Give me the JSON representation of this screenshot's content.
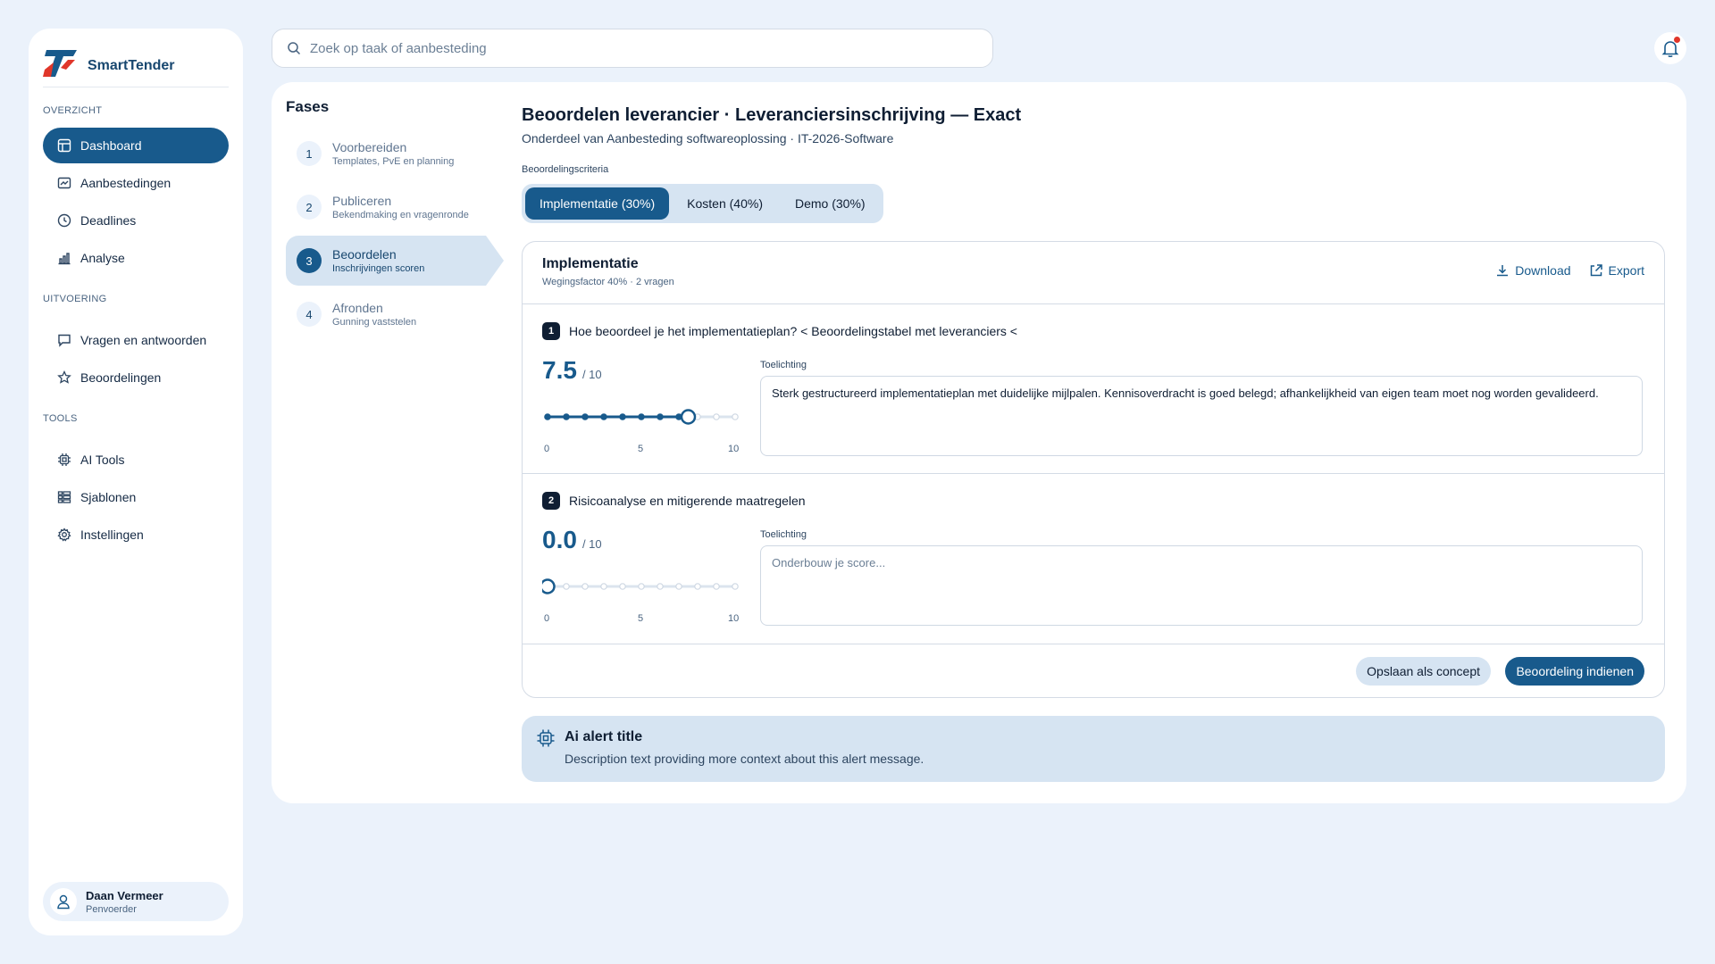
{
  "brand": {
    "name": "SmartTender"
  },
  "sidebar": {
    "sections": {
      "overview": "OVERZICHT",
      "execution": "UITVOERING",
      "tools": "TOOLS"
    },
    "items": [
      {
        "label": "Dashboard",
        "icon": "dashboard-icon",
        "active": true
      },
      {
        "label": "Aanbestedingen",
        "icon": "tenders-icon"
      },
      {
        "label": "Deadlines",
        "icon": "clock-icon"
      },
      {
        "label": "Analyse",
        "icon": "chart-icon"
      },
      {
        "label": "Vragen en antwoorden",
        "icon": "chat-icon"
      },
      {
        "label": "Beoordelingen",
        "icon": "star-icon"
      },
      {
        "label": "AI Tools",
        "icon": "chip-icon"
      },
      {
        "label": "Sjablonen",
        "icon": "templates-icon"
      },
      {
        "label": "Instellingen",
        "icon": "gear-icon"
      }
    ],
    "user": {
      "name": "Daan Vermeer",
      "role": "Penvoerder"
    }
  },
  "search": {
    "placeholder": "Zoek op taak of aanbesteding"
  },
  "phases": {
    "title": "Fases",
    "items": [
      {
        "num": "1",
        "title": "Voorbereiden",
        "sub": "Templates, PvE en planning"
      },
      {
        "num": "2",
        "title": "Publiceren",
        "sub": "Bekendmaking en vragenronde"
      },
      {
        "num": "3",
        "title": "Beoordelen",
        "sub": "Inschrijvingen scoren",
        "active": true
      },
      {
        "num": "4",
        "title": "Afronden",
        "sub": "Gunning vaststelen"
      }
    ]
  },
  "main": {
    "title": "Beoordelen leverancier · Leveranciersinschrijving — Exact",
    "subtitle": "Onderdeel van Aanbesteding softwareoplossing · IT-2026-Software",
    "criteria_label": "Beoordelingscriteria",
    "tabs": [
      {
        "label": "Implementatie (30%)",
        "active": true
      },
      {
        "label": "Kosten (40%)"
      },
      {
        "label": "Demo (30%)"
      }
    ]
  },
  "panel": {
    "title": "Implementatie",
    "subtitle": "Wegingsfactor 40% · 2 vragen",
    "download": "Download",
    "export": "Export",
    "questions": [
      {
        "num": "1",
        "text": "Hoe beoordeel je het implementatieplan? < Beoordelingstabel met leveranciers <",
        "score": "7.5",
        "max": "/ 10",
        "score_value": 7.5,
        "note_label": "Toelichting",
        "note": "Sterk gestructureerd implementatieplan met duidelijke mijlpalen. Kennisoverdracht is goed belegd; afhankelijkheid van eigen team moet nog worden gevalideerd.",
        "note_placeholder": ""
      },
      {
        "num": "2",
        "text": "Risicoanalyse en mitigerende maatregelen",
        "score": "0.0",
        "max": "/ 10",
        "score_value": 0,
        "note_label": "Toelichting",
        "note": "",
        "note_placeholder": "Onderbouw je score..."
      }
    ],
    "slider_labels": {
      "min": "0",
      "mid": "5",
      "max": "10"
    },
    "save_draft": "Opslaan als concept",
    "submit": "Beoordeling indienen"
  },
  "alert": {
    "title": "Ai alert title",
    "description": "Description text providing more context about this alert message."
  },
  "colors": {
    "primary": "#185a8c",
    "background": "#ebf2fb",
    "accent_light": "#d6e4f2",
    "notification_dot": "#e0362a"
  }
}
